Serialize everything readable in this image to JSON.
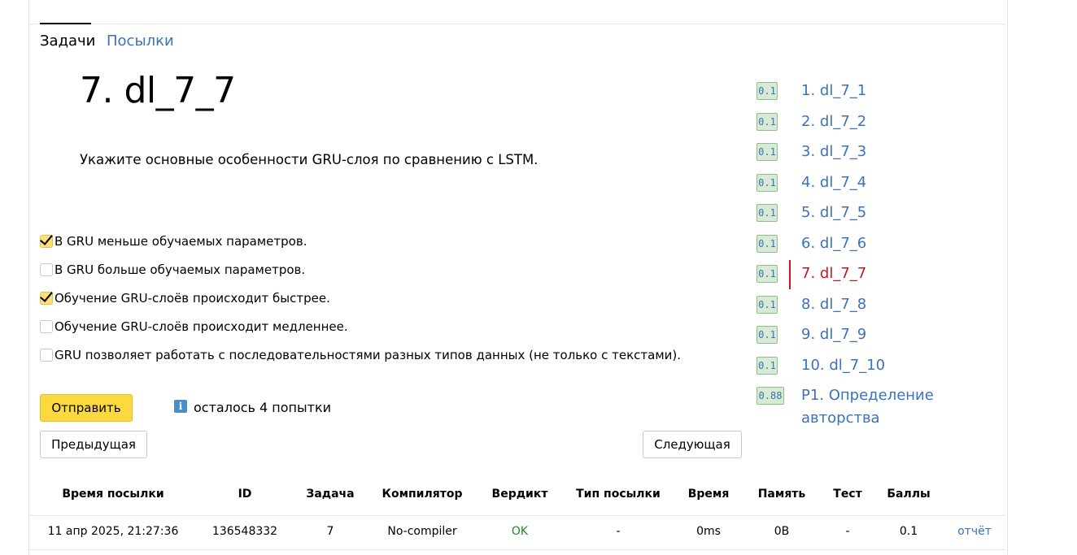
{
  "tabs": {
    "tasks": "Задачи",
    "submissions": "Посылки"
  },
  "problem": {
    "title": "7. dl_7_7",
    "statement": "Укажите основные особенности GRU-слоя по сравнению с LSTM."
  },
  "options": [
    {
      "label": "В GRU меньше обучаемых параметров.",
      "checked": true
    },
    {
      "label": "В GRU больше обучаемых параметров.",
      "checked": false
    },
    {
      "label": "Обучение GRU-слоёв происходит быстрее.",
      "checked": true
    },
    {
      "label": "Обучение GRU-слоёв происходит медленнее.",
      "checked": false
    },
    {
      "label": "GRU позволяет работать с последовательностями разных типов данных (не только с текстами).",
      "checked": false
    }
  ],
  "buttons": {
    "submit": "Отправить",
    "prev": "Предыдущая",
    "next": "Следующая"
  },
  "attempts_text": "осталось 4 попытки",
  "info_icon": "i",
  "problems": [
    {
      "score": "0.1",
      "label": "1. dl_7_1",
      "current": false
    },
    {
      "score": "0.1",
      "label": "2. dl_7_2",
      "current": false
    },
    {
      "score": "0.1",
      "label": "3. dl_7_3",
      "current": false
    },
    {
      "score": "0.1",
      "label": "4. dl_7_4",
      "current": false
    },
    {
      "score": "0.1",
      "label": "5. dl_7_5",
      "current": false
    },
    {
      "score": "0.1",
      "label": "6. dl_7_6",
      "current": false
    },
    {
      "score": "0.1",
      "label": "7. dl_7_7",
      "current": true
    },
    {
      "score": "0.1",
      "label": "8. dl_7_8",
      "current": false
    },
    {
      "score": "0.1",
      "label": "9. dl_7_9",
      "current": false
    },
    {
      "score": "0.1",
      "label": "10. dl_7_10",
      "current": false
    },
    {
      "score": "0.88",
      "label": "P1. Определение",
      "label2": "авторства",
      "current": false
    }
  ],
  "table": {
    "headers": [
      "Время посылки",
      "ID",
      "Задача",
      "Компилятор",
      "Вердикт",
      "Тип посылки",
      "Время",
      "Память",
      "Тест",
      "Баллы"
    ],
    "row": {
      "time": "11 апр 2025, 21:27:36",
      "id": "136548332",
      "task": "7",
      "compiler": "No-compiler",
      "verdict": "OK",
      "type": "-",
      "runtime": "0ms",
      "memory": "0B",
      "test": "-",
      "score": "0.1",
      "report": "отчёт"
    }
  },
  "colors": {
    "link": "#3b73b9",
    "current": "#c21a1a",
    "ok": "#1e8a1e",
    "primary": "#fcd93f"
  }
}
